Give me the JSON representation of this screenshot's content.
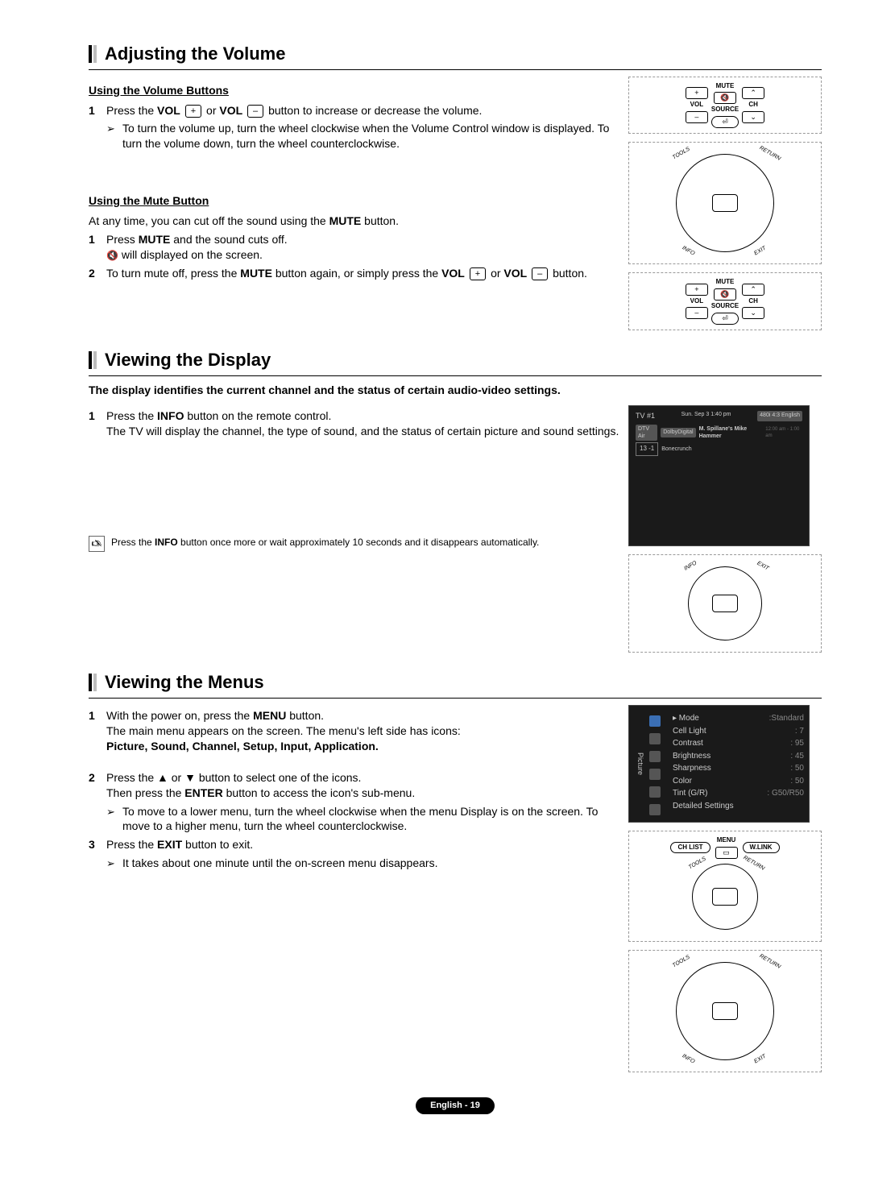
{
  "section1": {
    "title": "Adjusting the Volume",
    "sub1": "Using the Volume Buttons",
    "s1_num": "1",
    "s1_lead": "Press the ",
    "s1_vol1": "VOL",
    "s1_plus": "+",
    "s1_or": " or ",
    "s1_vol2": "VOL",
    "s1_minus": "–",
    "s1_tail": " button to increase or decrease the volume.",
    "s1_arrow": "To turn the volume up, turn the wheel clockwise when the Volume Control window is displayed. To turn the volume down, turn the wheel counterclockwise.",
    "sub2": "Using the Mute Button",
    "mute_intro_a": "At any time, you can cut off the sound using the ",
    "mute_intro_b": "MUTE",
    "mute_intro_c": " button.",
    "m1_num": "1",
    "m1_a": "Press ",
    "m1_b": "MUTE",
    "m1_c": " and the sound cuts off.",
    "m1_line2": " will displayed on the screen.",
    "m2_num": "2",
    "m2_a": "To turn mute off, press the ",
    "m2_b": "MUTE",
    "m2_c": " button again, or simply press the ",
    "m2_vol1": "VOL",
    "m2_plus": "+",
    "m2_or": " or ",
    "m2_vol2": "VOL",
    "m2_minus": "–",
    "m2_tail": " button."
  },
  "remote": {
    "mute": "MUTE",
    "vol": "VOL",
    "source": "SOURCE",
    "ch": "CH",
    "plus": "+",
    "minus": "–",
    "up": "⌃",
    "down": "⌄",
    "chlist": "CH LIST",
    "menu": "MENU",
    "wlink": "W.LINK",
    "tools": "TOOLS",
    "return": "RETURN",
    "info": "INFO",
    "exit": "EXIT"
  },
  "section2": {
    "title": "Viewing the Display",
    "intro": "The display identifies the current channel and the status of certain audio-video settings.",
    "s1_num": "1",
    "s1_a": "Press the ",
    "s1_b": "INFO",
    "s1_c": " button on the remote control.",
    "s1_line2": "The TV will display the channel, the type of sound, and the status of certain picture and sound settings.",
    "note_a": "Press the ",
    "note_b": "INFO",
    "note_c": " button once more or wait approximately 10 seconds and it disappears automatically."
  },
  "screen": {
    "tv": "TV #1",
    "date": "Sun. Sep 3  1:40 pm",
    "langb": "480i 4:3 English",
    "dtv": "DTV Air",
    "dd": "DolbyDigital",
    "show": "M. Spillane's Mike Hammer",
    "time": "12:00 am - 1:00 am",
    "ch": "13 -1",
    "sub": "Bonecrunch"
  },
  "section3": {
    "title": "Viewing the Menus",
    "s1_num": "1",
    "s1_a": "With the power on, press the ",
    "s1_b": "MENU",
    "s1_c": " button.",
    "s1_line2": "The main menu appears on the screen. The menu's left side has icons:",
    "s1_bold": "Picture, Sound, Channel, Setup, Input, Application.",
    "s2_num": "2",
    "s2_text": "Press the ▲ or ▼ button to select one of the icons.",
    "s2_line2a": "Then press the ",
    "s2_line2b": "ENTER",
    "s2_line2c": " button to access the icon's sub-menu.",
    "s2_arrow": "To move to a lower menu, turn the wheel clockwise when the menu Display is on the screen. To move to a higher menu, turn the wheel counterclockwise.",
    "s3_num": "3",
    "s3_a": "Press the ",
    "s3_b": "EXIT",
    "s3_c": " button to exit.",
    "s3_arrow": "It takes about one minute until the on-screen menu disappears."
  },
  "menu": {
    "side": "Picture",
    "items": [
      {
        "label": "Mode",
        "value": ":Standard"
      },
      {
        "label": "Cell Light",
        "value": ": 7"
      },
      {
        "label": "Contrast",
        "value": ": 95"
      },
      {
        "label": "Brightness",
        "value": ": 45"
      },
      {
        "label": "Sharpness",
        "value": ": 50"
      },
      {
        "label": "Color",
        "value": ": 50"
      },
      {
        "label": "Tint (G/R)",
        "value": ": G50/R50"
      },
      {
        "label": "Detailed Settings",
        "value": ""
      }
    ]
  },
  "footer": "English - 19"
}
